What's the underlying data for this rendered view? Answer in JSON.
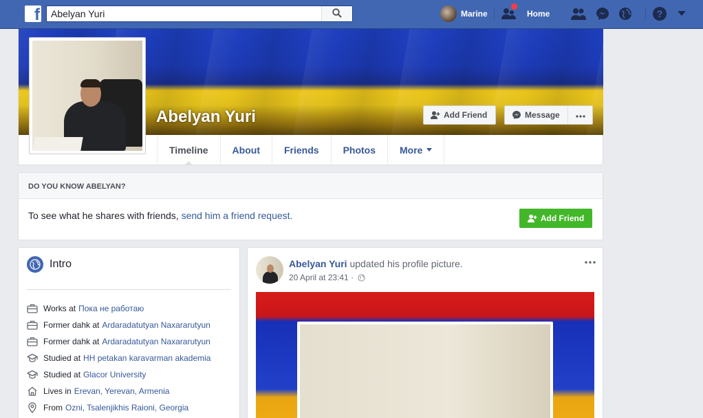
{
  "topbar": {
    "search_value": "Abelyan Yuri",
    "user_name": "Marine",
    "home_label": "Home",
    "brand_color": "#4267b2",
    "icons": [
      "friend-requests-icon",
      "messenger-icon",
      "notifications-globe-icon",
      "help-icon",
      "account-menu-caret-icon"
    ]
  },
  "profile": {
    "name": "Abelyan Yuri",
    "add_friend_label": "Add Friend",
    "message_label": "Message",
    "tabs": [
      "Timeline",
      "About",
      "Friends",
      "Photos",
      "More"
    ],
    "active_tab": "Timeline"
  },
  "know": {
    "heading": "DO YOU KNOW ABELYAN?",
    "text": "To see what he shares with friends, ",
    "link": "send him a friend request.",
    "button": "Add Friend",
    "button_color": "#42b72a"
  },
  "intro": {
    "title": "Intro",
    "items": [
      {
        "icon": "briefcase-icon",
        "prefix": "Works at",
        "link": "Пока не работаю"
      },
      {
        "icon": "briefcase-icon",
        "prefix": "Former dahk at",
        "link": "Ardaradatutyan Naxararutyun"
      },
      {
        "icon": "briefcase-icon",
        "prefix": "Former dahk at",
        "link": "Ardaradatutyan Naxararutyun"
      },
      {
        "icon": "graduation-cap-icon",
        "prefix": "Studied at",
        "link": "HH petakan karavarman akademia"
      },
      {
        "icon": "graduation-cap-icon",
        "prefix": "Studied at",
        "link": "Glacor University"
      },
      {
        "icon": "home-icon",
        "prefix": "Lives in",
        "link": "Erevan, Yerevan, Armenia"
      },
      {
        "icon": "location-pin-icon",
        "prefix": "From",
        "link": "Ozni, Tsalenjikhis Raioni, Georgia"
      }
    ]
  },
  "post": {
    "author": "Abelyan Yuri",
    "action": "updated his profile picture.",
    "time": "20 April at 23:41 ·"
  }
}
